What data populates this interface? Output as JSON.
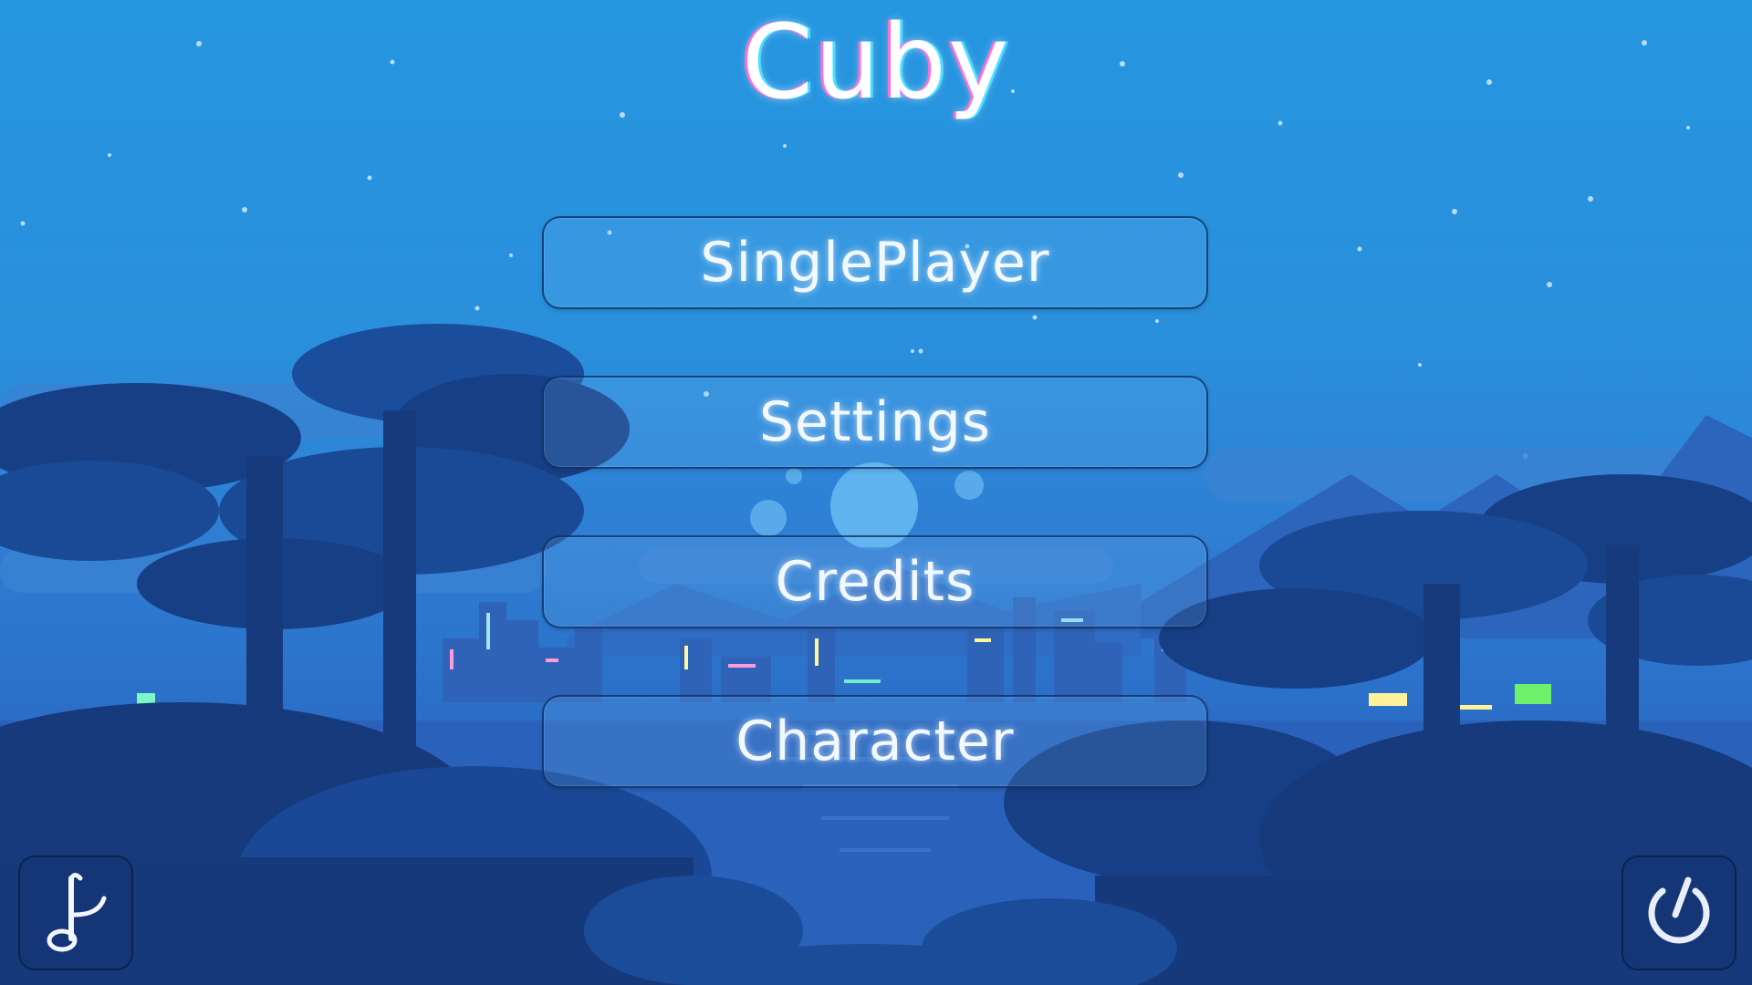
{
  "game": {
    "title": "Cuby"
  },
  "menu": {
    "singleplayer_label": "SinglePlayer",
    "settings_label": "Settings",
    "credits_label": "Credits",
    "character_label": "Character"
  },
  "corner_buttons": {
    "music_icon": "music-note-icon",
    "quit_icon": "power-icon"
  },
  "colors": {
    "sky": "#2596e0",
    "tree_dark": "#173f86",
    "tree_mid": "#1f52a3",
    "mountain": "#2d6cc3",
    "water": "#2b66c0",
    "title_glow_pink": "#ff6fd5",
    "title_glow_cyan": "#4de0ff"
  }
}
